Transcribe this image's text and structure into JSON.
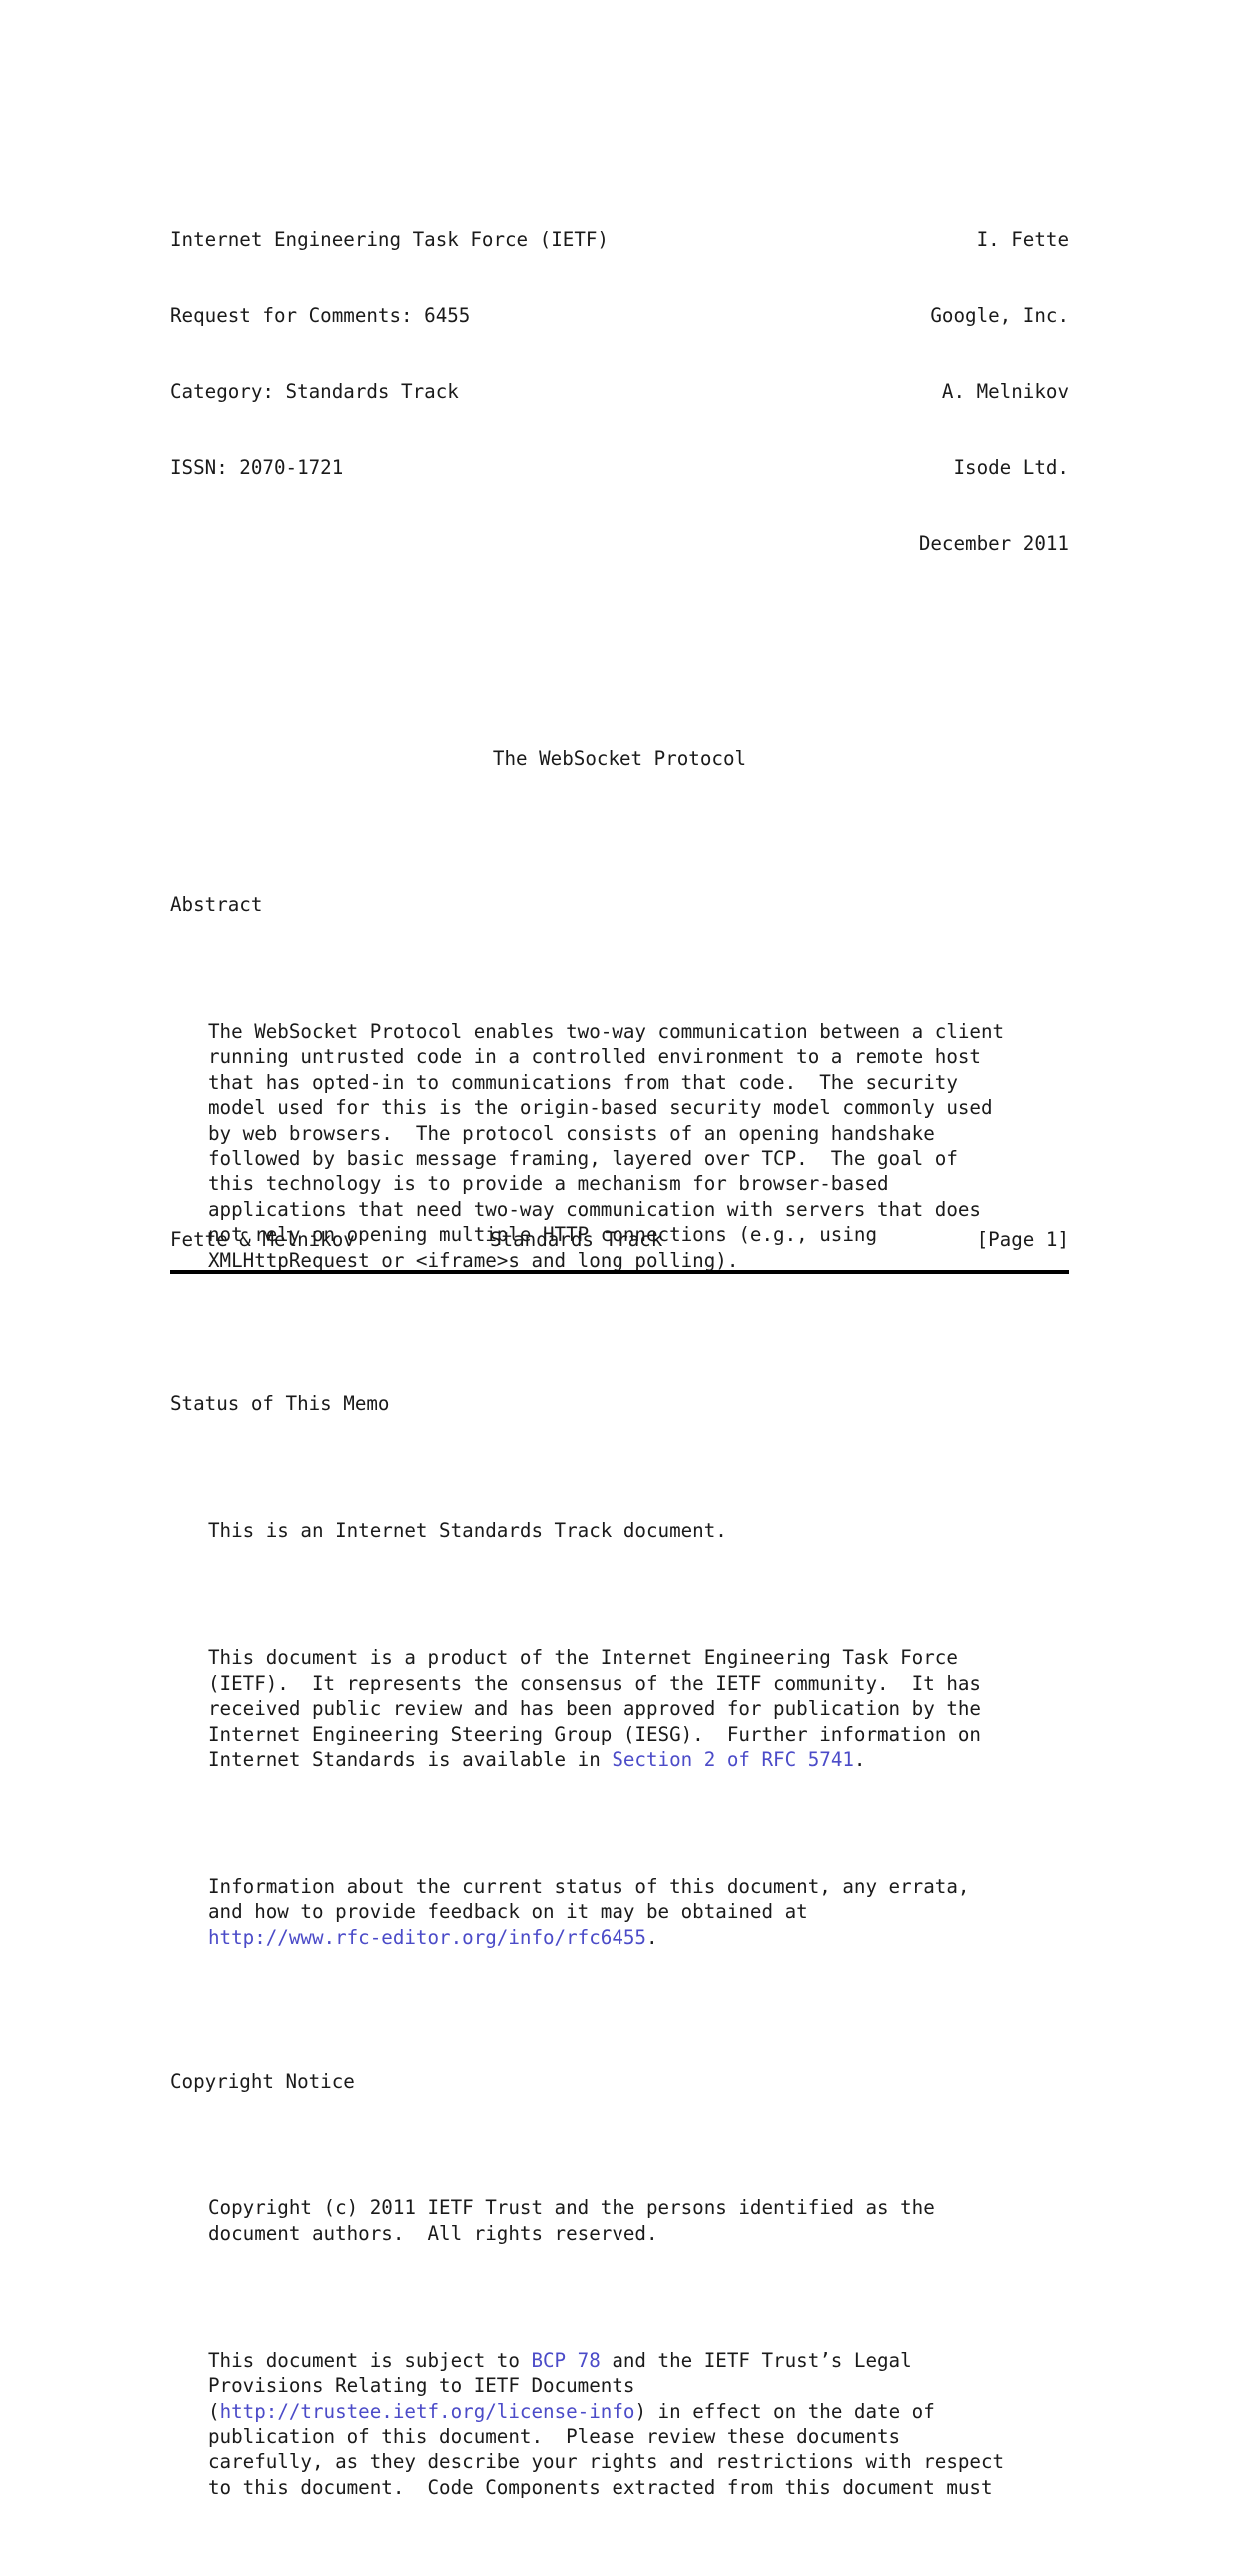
{
  "document": {
    "header": {
      "left_lines": [
        "Internet Engineering Task Force (IETF)",
        "Request for Comments: 6455",
        "Category: Standards Track",
        "ISSN: 2070-1721"
      ],
      "right_lines": [
        "I. Fette",
        "Google, Inc.",
        "A. Melnikov",
        "Isode Ltd.",
        "December 2011"
      ]
    },
    "title": "The WebSocket Protocol",
    "sections": [
      {
        "heading": "Abstract",
        "paragraphs": [
          "The WebSocket Protocol enables two-way communication between a client\nrunning untrusted code in a controlled environment to a remote host\nthat has opted-in to communications from that code.  The security\nmodel used for this is the origin-based security model commonly used\nby web browsers.  The protocol consists of an opening handshake\nfollowed by basic message framing, layered over TCP.  The goal of\nthis technology is to provide a mechanism for browser-based\napplications that need two-way communication with servers that does\nnot rely on opening multiple HTTP connections (e.g., using\nXMLHttpRequest or <iframe>s and long polling)."
        ]
      },
      {
        "heading": "Status of This Memo",
        "paragraphs": [
          "This is an Internet Standards Track document."
        ]
      }
    ],
    "status_para_2": {
      "before_link": "This document is a product of the Internet Engineering Task Force\n(IETF).  It represents the consensus of the IETF community.  It has\nreceived public review and has been approved for publication by the\nInternet Engineering Steering Group (IESG).  Further information on\nInternet Standards is available in ",
      "link": "Section 2 of RFC 5741",
      "after_link": "."
    },
    "status_para_3": {
      "before_link": "Information about the current status of this document, any errata,\nand how to provide feedback on it may be obtained at\n",
      "link": "http://www.rfc-editor.org/info/rfc6455",
      "after_link": "."
    },
    "copyright": {
      "heading": "Copyright Notice",
      "para_1": "Copyright (c) 2011 IETF Trust and the persons identified as the\ndocument authors.  All rights reserved.",
      "para_2": {
        "part_1": "This document is subject to ",
        "link_1": "BCP 78",
        "part_2": " and the IETF Trust’s Legal\nProvisions Relating to IETF Documents\n(",
        "link_2": "http://trustee.ietf.org/license-info",
        "part_3": ") in effect on the date of\npublication of this document.  Please review these documents\ncarefully, as they describe your rights and restrictions with respect\nto this document.  Code Components extracted from this document must"
      }
    },
    "footer": {
      "authors": "Fette & Melnikov",
      "category": "Standards Track",
      "page": "[Page 1]"
    },
    "colors": {
      "link": "#4b4bc8",
      "text": "#1a1a1a",
      "background": "#ffffff",
      "rule": "#000000"
    }
  }
}
